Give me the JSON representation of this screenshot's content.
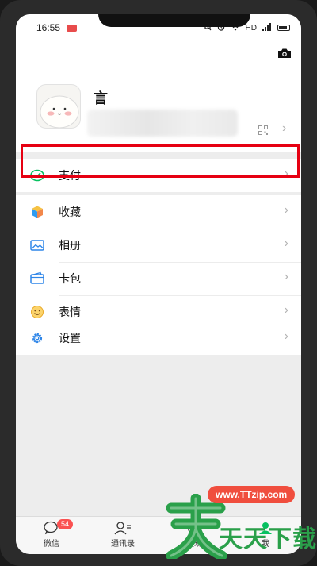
{
  "status_bar": {
    "time": "16:55",
    "net_label": "HD"
  },
  "profile": {
    "name": "言"
  },
  "menu_payment": [
    {
      "label": "支付",
      "icon": "wechat-pay-icon"
    }
  ],
  "menu_main": [
    {
      "label": "收藏",
      "icon": "favorites-cube-icon"
    },
    {
      "label": "相册",
      "icon": "album-icon"
    },
    {
      "label": "卡包",
      "icon": "card-wallet-icon"
    },
    {
      "label": "表情",
      "icon": "sticker-smile-icon"
    }
  ],
  "menu_settings": [
    {
      "label": "设置",
      "icon": "gear-icon"
    }
  ],
  "chevron": "›",
  "tabs": [
    {
      "label": "微信",
      "badge": "54",
      "icon": "chat-icon"
    },
    {
      "label": "通讯录",
      "icon": "contacts-icon"
    },
    {
      "label": "发现",
      "icon": "discover-icon"
    },
    {
      "label": "我",
      "icon": "me-icon"
    }
  ],
  "watermark": {
    "url": "www.TTzip.com",
    "name": "天天下载",
    "logo_char": "天"
  },
  "colors": {
    "wechat_green": "#07c160",
    "highlight_red": "#e60012",
    "badge_red": "#fa5151"
  }
}
